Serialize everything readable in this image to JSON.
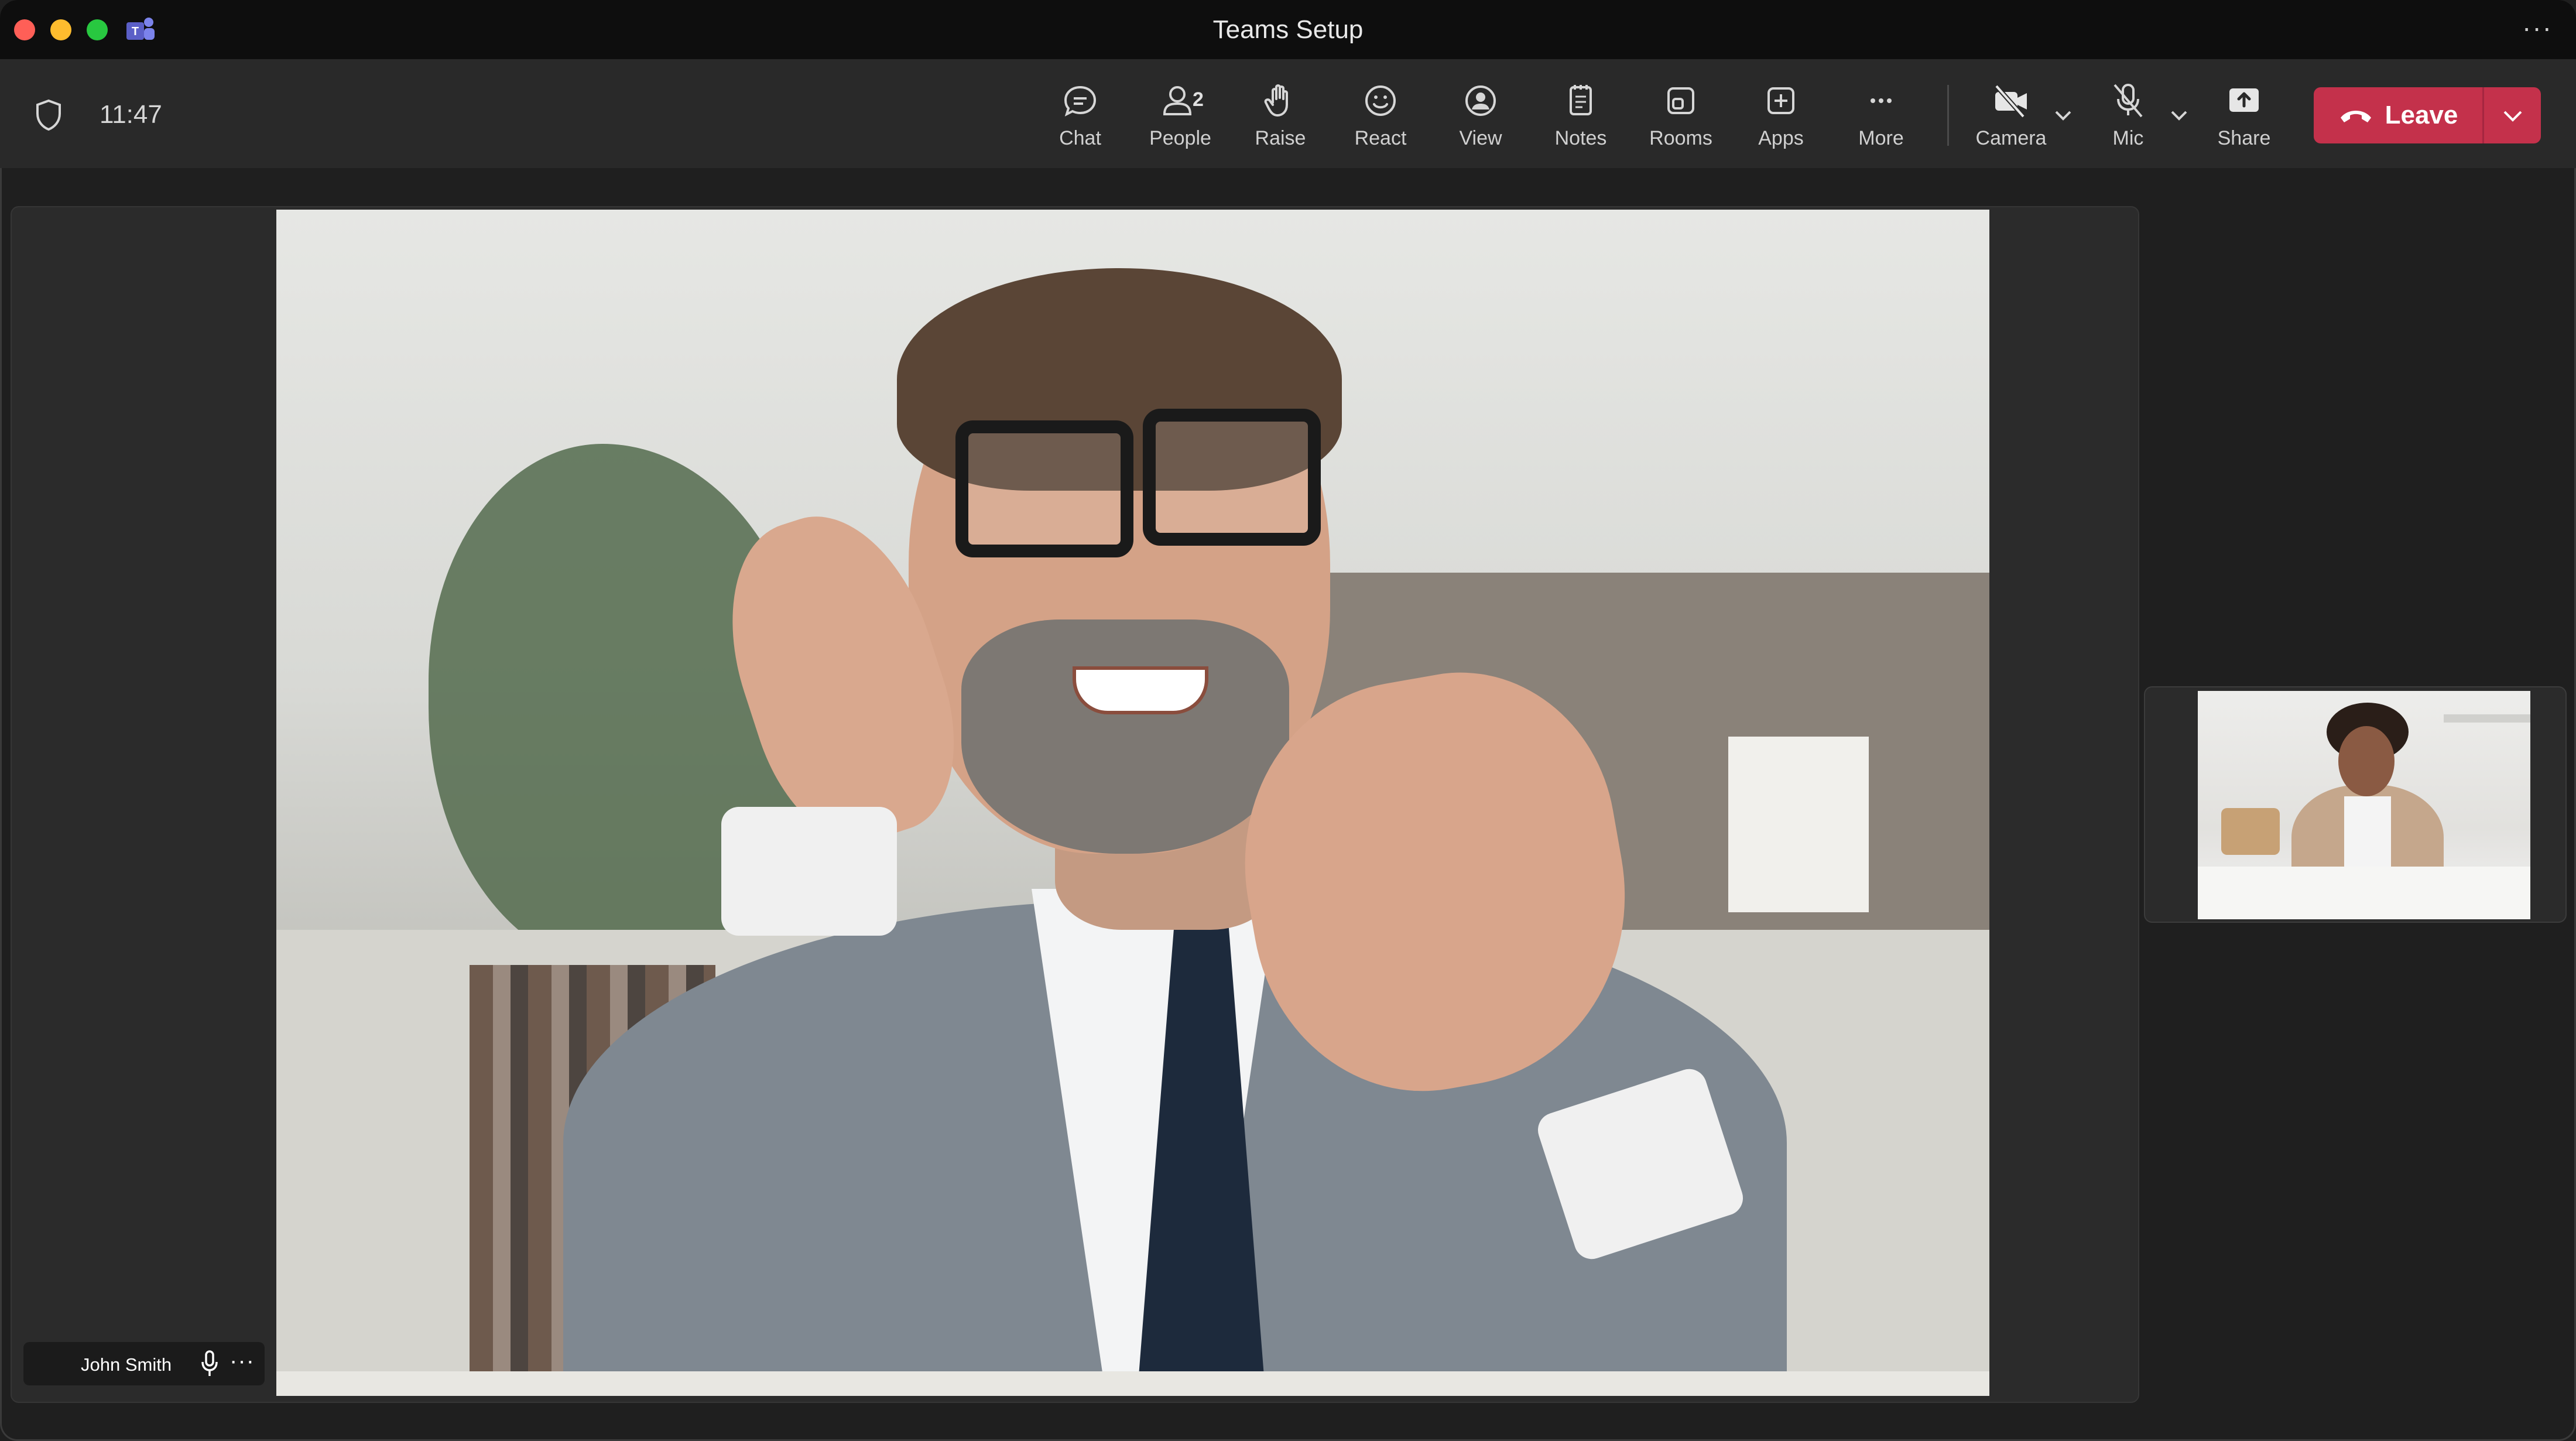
{
  "window": {
    "title": "Teams Setup",
    "more_label": "···"
  },
  "meeting": {
    "elapsed": "11:47"
  },
  "toolbar": {
    "chat": "Chat",
    "people": "People",
    "people_count": "2",
    "raise": "Raise",
    "react": "React",
    "view": "View",
    "notes": "Notes",
    "rooms": "Rooms",
    "apps": "Apps",
    "more": "More",
    "camera": "Camera",
    "mic": "Mic",
    "share": "Share",
    "leave": "Leave"
  },
  "participants": {
    "main": {
      "name": "John Smith",
      "more_label": "···"
    }
  },
  "colors": {
    "leave_red": "#c4314b",
    "titlebar": "#0e0e0e",
    "toolbar": "#292929"
  },
  "icons": {
    "chat": "chat-bubble-icon",
    "people": "person-icon",
    "raise": "raised-hand-icon",
    "react": "smiley-icon",
    "view": "view-icon",
    "notes": "notes-icon",
    "rooms": "rooms-icon",
    "apps": "plus-square-icon",
    "more": "ellipsis-icon",
    "camera": "camera-off-icon",
    "mic": "mic-off-icon",
    "share": "share-tray-icon",
    "leave": "phone-hangup-icon"
  }
}
